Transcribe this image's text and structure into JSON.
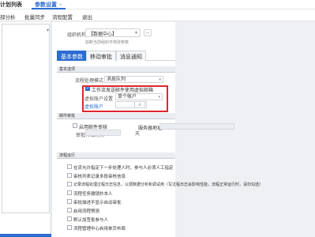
{
  "tabs": {
    "prev": "计划列表",
    "active": "参数设置",
    "close": "×"
  },
  "toolbar": {
    "item1": "部分析",
    "item2": "批量同步",
    "item3": "流程配置",
    "item4": "退出"
  },
  "org": {
    "label": "组织机构",
    "value": "【数据中心】",
    "more": "...",
    "hint": "如断当前组织平修改参数"
  },
  "subtabs": [
    "基本参数",
    "移动审批",
    "消息通知"
  ],
  "section1": {
    "title": "基本选项"
  },
  "basic": {
    "mode_label": "流程处理模式",
    "mode_value": "消息队列",
    "email_check": "工作流发送邮件使用虚拟邮箱",
    "virtual_label": "虚拟账户设置",
    "virtual_value": "单个帐户",
    "account_label": "虚拟帐户",
    "account_value": ""
  },
  "section2": {
    "title": "邮件审批"
  },
  "mail": {
    "enable": "启用邮件审核",
    "server_label": "服务器地址",
    "period_label": "审批有效时间",
    "day_unit": "天"
  },
  "section3": {
    "title": "流程运行"
  },
  "run_options": [
    "在流允许指定下一步处理人时，参与人必须人工指定",
    "审核列表记录多段审核信息",
    "记录流程处理过程日志信息，以便数据分析和调试用（写过程日志会影响性能，流程正常运行时，请勿勾选）",
    "流程任务撤销抄本人",
    "审批描述不显示自动审批",
    "启用流程预测",
    "默认加签批参与人",
    "流程管理中心启用单页布局"
  ],
  "icons": {
    "search": "search-icon",
    "chevron": "chevron-down-icon"
  },
  "colors": {
    "accent": "#2b6cd1",
    "highlight": "#e0262e"
  }
}
